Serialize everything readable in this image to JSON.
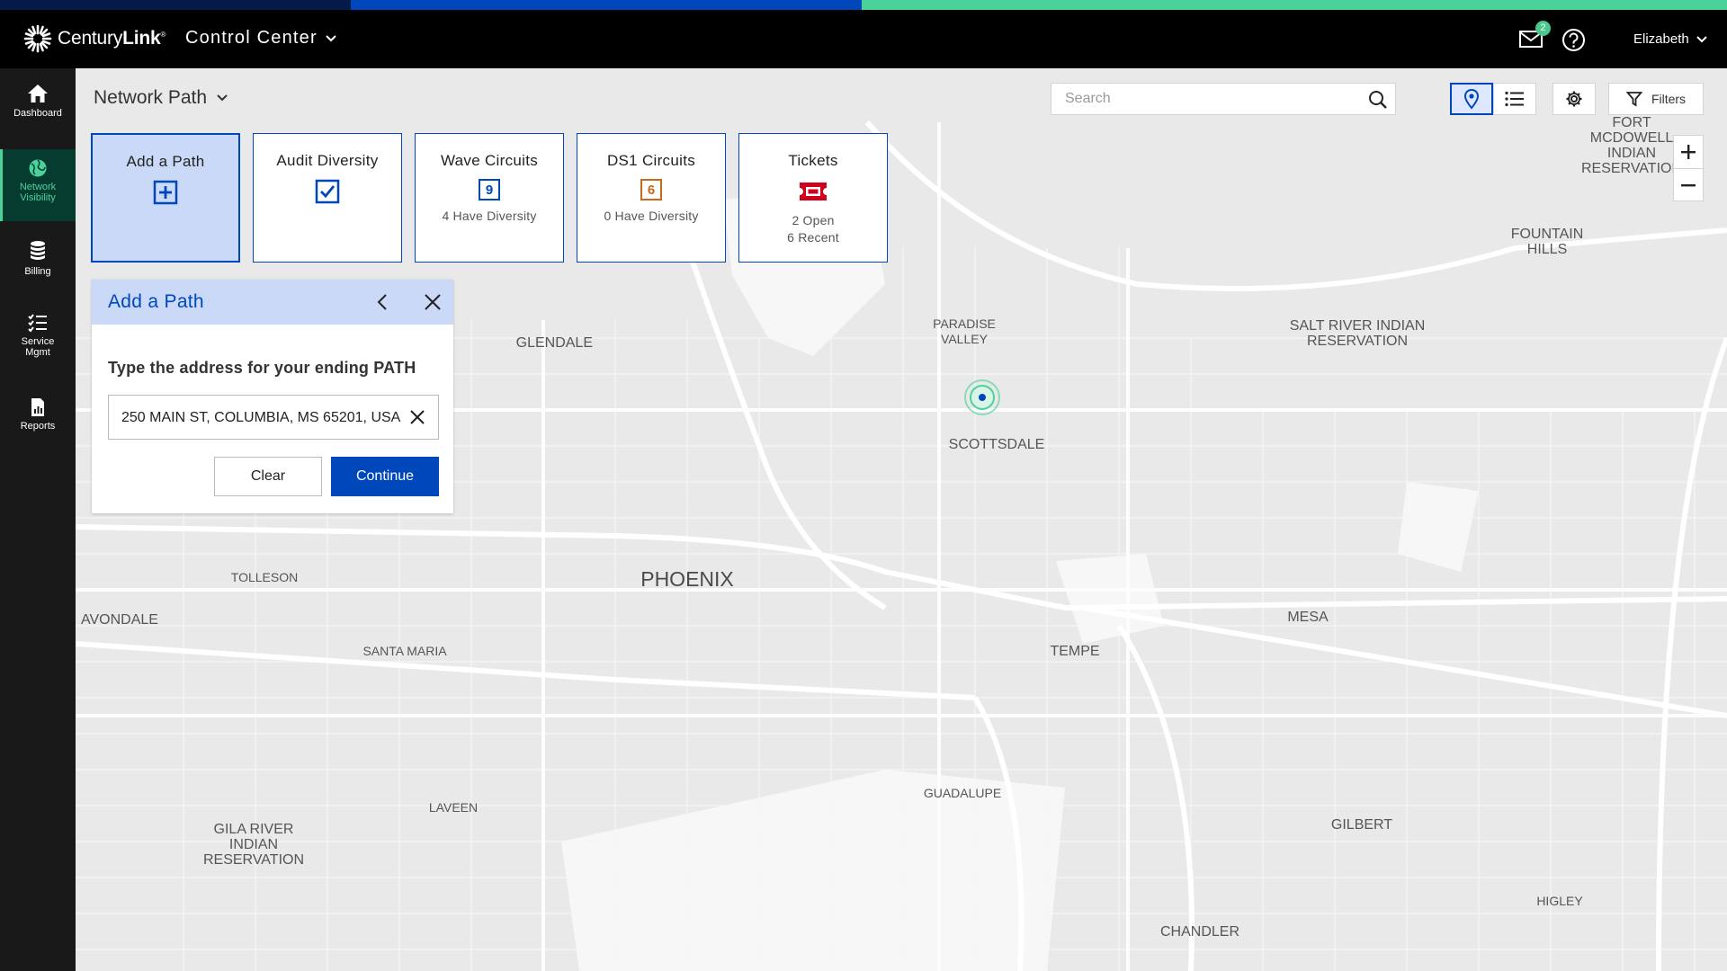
{
  "colors": {
    "strip": [
      "#041a4a",
      "#0047bb",
      "#4bd19a"
    ],
    "accent": "#0047bb",
    "brand_green": "#4bd19a",
    "ticket_red": "#d0021b",
    "ds1_orange": "#c86a1a"
  },
  "header": {
    "brand_light": "Century",
    "brand_bold": "Link",
    "app_name": "Control Center",
    "mail_count": "2",
    "user_name": "Elizabeth"
  },
  "sidebar": {
    "items": [
      {
        "label": "Dashboard",
        "icon": "home-icon"
      },
      {
        "label": "Network Visibility",
        "icon": "globe-icon",
        "active": true
      },
      {
        "label": "Billing",
        "icon": "coins-icon"
      },
      {
        "label": "Service Mgmt",
        "icon": "checklist-icon"
      },
      {
        "label": "Reports",
        "icon": "report-icon"
      }
    ]
  },
  "page": {
    "title": "Network Path"
  },
  "search": {
    "placeholder": "Search"
  },
  "toolbar": {
    "filters_label": "Filters"
  },
  "cards": [
    {
      "title": "Add a Path",
      "icon": "plus-square-icon",
      "active": true
    },
    {
      "title": "Audit Diversity",
      "icon": "checkbox-icon"
    },
    {
      "title": "Wave Circuits",
      "count": "9",
      "sub1": "4 Have Diversity"
    },
    {
      "title": "DS1 Circuits",
      "count": "6",
      "sub1": "0 Have Diversity"
    },
    {
      "title": "Tickets",
      "icon": "ticket-icon",
      "sub1": "2 Open",
      "sub2": "6 Recent"
    }
  ],
  "add_path": {
    "title": "Add a Path",
    "prompt": "Type the address for your ending PATH",
    "address_value": "250 MAIN ST, COLUMBIA, MS 65201, USA",
    "clear_label": "Clear",
    "continue_label": "Continue"
  },
  "map": {
    "labels": [
      "FORT MCDOWELL INDIAN RESERVATION",
      "FOUNTAIN HILLS",
      "PARADISE VALLEY",
      "SALT RIVER INDIAN RESERVATION",
      "SCOTTSDALE",
      "GLENDALE",
      "TOLLESON",
      "PHOENIX",
      "AVONDALE",
      "SANTA MARIA",
      "TEMPE",
      "MESA",
      "GUADALUPE",
      "LAVEEN",
      "GILA RIVER INDIAN RESERVATION",
      "GILBERT",
      "HIGLEY",
      "CHANDLER"
    ]
  }
}
